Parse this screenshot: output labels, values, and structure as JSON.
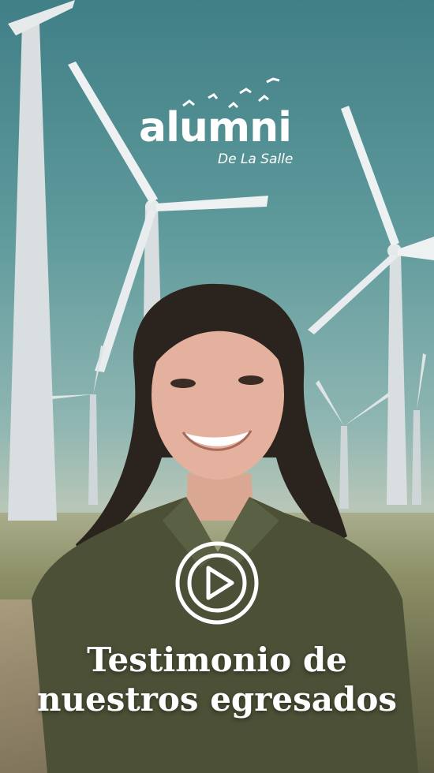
{
  "brand": {
    "wordmark": "alumni",
    "subtitle": "De La Salle"
  },
  "video": {
    "play_icon": "play-circle-icon"
  },
  "headline": {
    "line1": "Testimonio de",
    "line2": "nuestros egresados"
  },
  "colors": {
    "sky": "#4f8a8f",
    "text": "#ffffff",
    "shirt": "#4a4f36"
  }
}
